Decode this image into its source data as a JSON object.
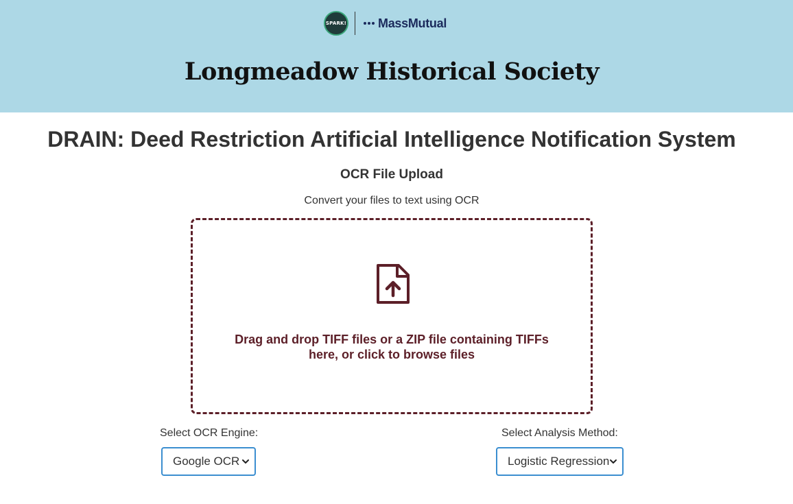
{
  "header": {
    "spark_logo_text": "SPARK!",
    "sponsor_logo_text": "MassMutual",
    "site_title": "Longmeadow Historical Society",
    "background_color": "#add8e6"
  },
  "main": {
    "app_title": "DRAIN: Deed Restriction Artificial Intelligence Notification System",
    "upload_title": "OCR File Upload",
    "upload_subtitle": "Convert your files to text using OCR"
  },
  "dropzone": {
    "icon": "file-upload-icon",
    "text_line1": "Drag and drop TIFF files or a ZIP file containing TIFFs",
    "text_line2": "here, or click to browse files",
    "accent_color": "#5c1f28"
  },
  "controls": {
    "ocr_engine": {
      "label": "Select OCR Engine:",
      "selected": "Google OCR"
    },
    "analysis_method": {
      "label": "Select Analysis Method:",
      "selected": "Logistic Regression"
    },
    "select_border_color": "#3b8ed0"
  }
}
